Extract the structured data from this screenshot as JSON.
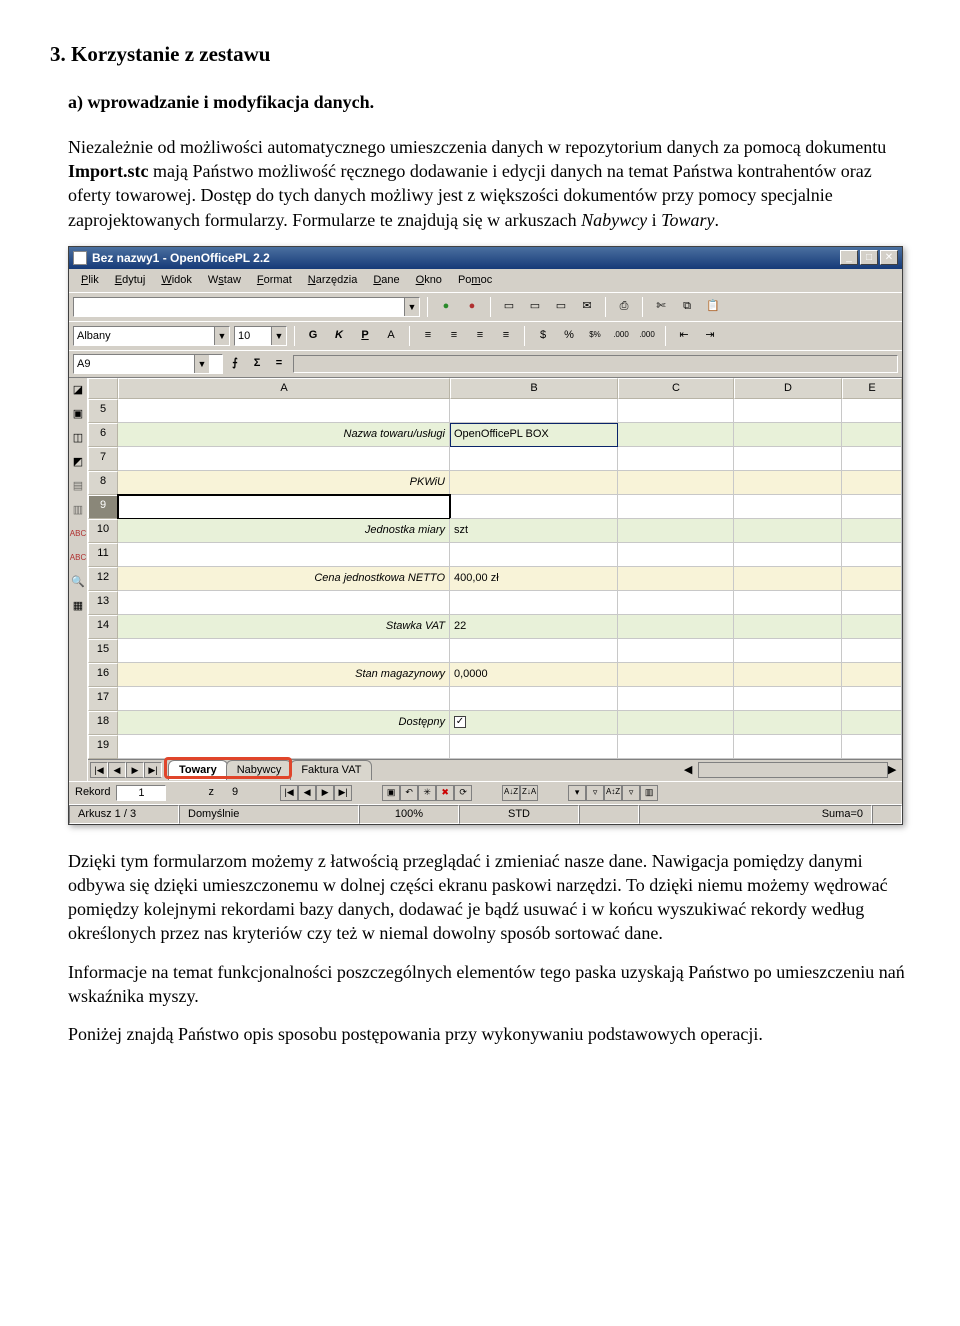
{
  "doc": {
    "heading": "3. Korzystanie z zestawu",
    "subheading": "a) wprowadzanie i modyfikacja danych.",
    "p1a": "Niezależnie od możliwości automatycznego umieszczenia danych w repozytorium danych za pomocą dokumentu ",
    "p1b": "Import.stc",
    "p1c": " mają Państwo możliwość ręcznego dodawanie i edycji danych na temat Państwa kontrahentów oraz oferty towarowej. Dostęp do tych danych możliwy jest z większości dokumentów przy pomocy specjalnie zaprojektowanych formularzy. Formularze te znajdują się w arkuszach ",
    "p1d": "Nabywcy",
    "p1e": " i ",
    "p1f": "Towary",
    "p1g": ".",
    "p2": "Dzięki tym formularzom możemy z łatwością przeglądać i zmieniać nasze dane. Nawigacja pomiędzy danymi odbywa się dzięki umieszczonemu w dolnej części ekranu paskowi narzędzi. To dzięki niemu możemy wędrować pomiędzy kolejnymi rekordami bazy danych, dodawać je bądź usuwać i w końcu wyszukiwać rekordy według określonych przez nas kryteriów czy też w niemal dowolny sposób sortować dane.",
    "p3": "Informacje na temat funkcjonalności poszczególnych elementów tego paska uzyskają Państwo po umieszczeniu nań wskaźnika myszy.",
    "p4": "Poniżej znajdą Państwo opis sposobu postępowania przy wykonywaniu podstawowych operacji."
  },
  "window": {
    "title": "Bez nazwy1 - OpenOfficePL 2.2"
  },
  "menus": [
    "Plik",
    "Edytuj",
    "Widok",
    "Wstaw",
    "Format",
    "Narzędzia",
    "Dane",
    "Okno",
    "Pomoc"
  ],
  "font": {
    "name": "Albany",
    "size": "10"
  },
  "cell_ref": "A9",
  "columns": [
    "",
    "A",
    "B",
    "C",
    "D",
    "E"
  ],
  "rows": [
    {
      "n": "5",
      "a": "",
      "b": ""
    },
    {
      "n": "6",
      "a": "Nazwa towaru/usługi",
      "b": "OpenOfficePL BOX"
    },
    {
      "n": "7",
      "a": "",
      "b": ""
    },
    {
      "n": "8",
      "a": "PKWiU",
      "b": ""
    },
    {
      "n": "9",
      "a": "",
      "b": ""
    },
    {
      "n": "10",
      "a": "Jednostka miary",
      "b": "szt"
    },
    {
      "n": "11",
      "a": "",
      "b": ""
    },
    {
      "n": "12",
      "a": "Cena jednostkowa NETTO",
      "b": "400,00 zł"
    },
    {
      "n": "13",
      "a": "",
      "b": ""
    },
    {
      "n": "14",
      "a": "Stawka VAT",
      "b": "22"
    },
    {
      "n": "15",
      "a": "",
      "b": ""
    },
    {
      "n": "16",
      "a": "Stan magazynowy",
      "b": "0,0000"
    },
    {
      "n": "17",
      "a": "",
      "b": ""
    },
    {
      "n": "18",
      "a": "Dostępny",
      "b": "__CHECK__"
    },
    {
      "n": "19",
      "a": "",
      "b": ""
    }
  ],
  "tabs": [
    "Towary",
    "Nabywcy",
    "Faktura VAT"
  ],
  "record": {
    "label": "Rekord",
    "current": "1",
    "of_label": "z",
    "total": "9"
  },
  "status": {
    "sheet": "Arkusz 1 / 3",
    "style": "Domyślnie",
    "zoom": "100%",
    "std": "STD",
    "sum": "Suma=0"
  },
  "icons": {
    "bold": "G",
    "italic": "K",
    "under": "P",
    "strike": "A",
    "al": "≡",
    "ac": "≡",
    "ar": "≡",
    "aj": "≡",
    "currency": "$",
    "percent": "%",
    "sci": "$%",
    "dec1": ".000",
    "dec2": ".000",
    "circle_g": "●",
    "circle_r": "●",
    "doc": "▭",
    "print": "⎙",
    "cut": "✄",
    "copy": "⧉",
    "paste": "📋",
    "first": "|◀",
    "prev": "◀",
    "next": "▶",
    "last": "▶|",
    "sigma": "Σ",
    "eq": "="
  }
}
